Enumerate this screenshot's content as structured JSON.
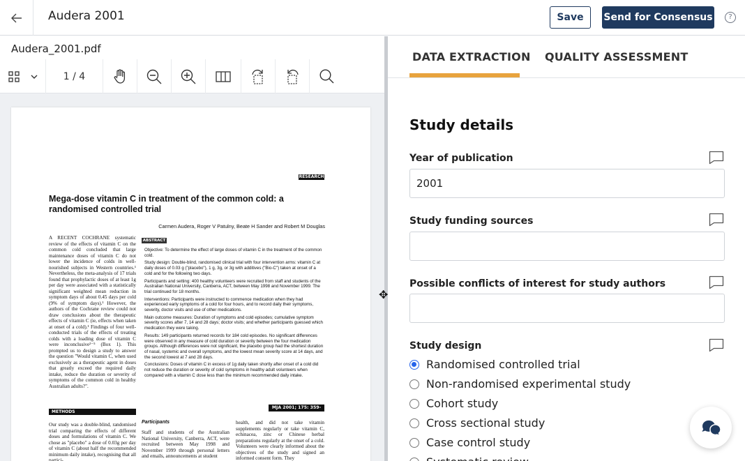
{
  "header": {
    "title": "Audera 2001",
    "save_label": "Save",
    "send_label": "Send for Consensus",
    "help_label": "?"
  },
  "viewer": {
    "file_name": "Audera_2001.pdf",
    "page_indicator": "1 / 4",
    "paper": {
      "badge": "RESEARCH",
      "title": "Mega-dose vitamin C in treatment of the common cold: a randomised controlled trial",
      "authors": "Carmen Audera, Roger V Patulny, Beate H Sander and Robert M Douglas",
      "abstract_head": "ABSTRACT",
      "intro_col": "A RECENT COCHRANE systematic review of the effects of vitamin C on the common cold concluded that large maintenance doses of vitamin C do not lower the incidence of colds in well-nourished subjects in Western countries.¹ Nevertheless, the meta-analysis of 17 trials found that prophylactic doses of at least 1g per day were associated with a statistically significant weighted mean reduction in symptom days of about 0.45 days per cold (9% of symptom days).¹ However, the authors of the Cochrane review could not draw conclusions about the therapeutic effects of vitamin C (ie, effects when taken at onset of a cold).¹ Findings of four well-conducted trials of the effects of treating colds with a loading dose of vitamin C were inconclusive²⁻⁵ (Box 1). This prompted us to design a study to answer the question \"Would vitamin C, when used exclusively as a therapeutic agent in doses that greatly exceed the required daily intake, reduce the duration or severity of symptoms of the common cold in healthy Australian adults?\".",
      "objective": "Objective: To determine the effect of large doses of vitamin C in the treatment of the common cold.",
      "design": "Study design: Double-blind, randomised clinical trial with four intervention arms: vitamin C at daily doses of 0.03 g (\"placebo\"), 1 g, 3g, or 3g with additives (\"Bio-C\") taken at onset of a cold and for the following two days.",
      "participants": "Participants and setting: 400 healthy volunteers were recruited from staff and students of the Australian National University, Canberra, ACT, between May 1998 and November 1999. The trial continued for 18 months.",
      "interventions": "Interventions: Participants were instructed to commence medication when they had experienced early symptoms of a cold for four hours, and to record daily their symptoms, severity, doctor visits and use of other medications.",
      "outcome": "Main outcome measures: Duration of symptoms and cold episodes; cumulative symptom severity scores after 7, 14 and 28 days; doctor visits; and whether participants guessed which medication they were taking.",
      "results": "Results: 149 participants returned records for 184 cold episodes. No significant differences were observed in any measure of cold duration or severity between the four medication groups. Although differences were not significant, the placebo group had the shortest duration of nasal, systemic and overall symptoms, and the lowest mean severity score at 14 days, and the second lowest at 7 and 28 days.",
      "conclusions": "Conclusions: Doses of vitamin C in excess of 1g daily taken shortly after onset of a cold did not reduce the duration or severity of cold symptoms in healthy adult volunteers when compared with a vitamin C dose less than the minimum recommended daily intake.",
      "methods_head": "METHODS",
      "mja_ref": "MJA 2001; 175: 359-362",
      "methods_text": "Our study was a double-blind, randomised trial comparing the effects of different doses and formulations of vitamin C. We chose as \"placebo\" a dose of 0.03g per day of vitamin C (about half the recommended minimum daily intake), recognising that all partici-",
      "participants_head": "Participants",
      "participants_text": "Staff and students of the Australian National University, Canberra, ACT, were recruited between May 1998 and November 1999 through personal letters and emails, announcements at student",
      "col3_text": "health, and did not take vitamin supplements regularly or take vitamin C, echinacea, zinc or Chinese herbal preparations regularly at the onset of a cold. Volunteers were clearly informed about the objectives of the study and signed an informed consent form. They"
    }
  },
  "panel": {
    "tabs": [
      {
        "label": "DATA EXTRACTION"
      },
      {
        "label": "QUALITY ASSESSMENT"
      }
    ],
    "section_title": "Study details",
    "fields": {
      "year": {
        "label": "Year of publication",
        "value": "2001"
      },
      "funding": {
        "label": "Study funding sources",
        "value": ""
      },
      "conflicts": {
        "label": "Possible conflicts of interest for study authors",
        "value": ""
      },
      "design": {
        "label": "Study design"
      }
    },
    "design_options": [
      {
        "label": "Randomised controlled trial"
      },
      {
        "label": "Non-randomised experimental study"
      },
      {
        "label": "Cohort study"
      },
      {
        "label": "Cross sectional study"
      },
      {
        "label": "Case control study"
      },
      {
        "label": "Systematic review"
      }
    ],
    "selected_design": "Randomised controlled trial"
  },
  "icons": {
    "back": "arrow-left-icon",
    "chat": "chat-bubbles-icon"
  },
  "colors": {
    "primary": "#1f3a5f",
    "tab_accent": "#e8a33d",
    "radio": "#2563eb"
  }
}
